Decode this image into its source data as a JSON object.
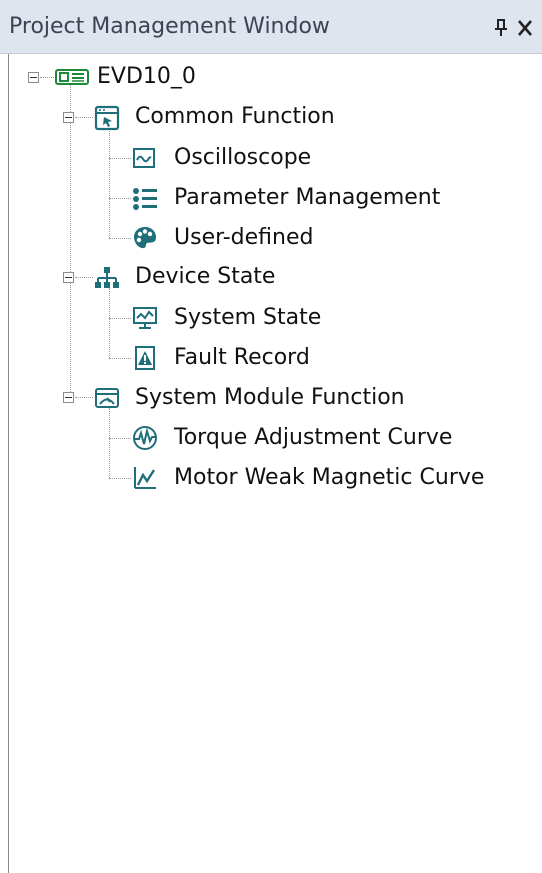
{
  "window": {
    "title": "Project Management Window",
    "pin_label": "pin",
    "close_label": "close"
  },
  "tree": {
    "root": {
      "label": "EVD10_0",
      "icon": "device-icon"
    },
    "groups": [
      {
        "label": "Common Function",
        "icon": "window-cursor-icon",
        "children": [
          {
            "label": "Oscilloscope",
            "icon": "waveform-icon"
          },
          {
            "label": "Parameter Management",
            "icon": "list-icon"
          },
          {
            "label": "User-defined",
            "icon": "palette-icon"
          }
        ]
      },
      {
        "label": "Device State",
        "icon": "network-tree-icon",
        "children": [
          {
            "label": "System State",
            "icon": "monitor-icon"
          },
          {
            "label": "Fault Record",
            "icon": "fault-record-icon"
          }
        ]
      },
      {
        "label": "System Module Function",
        "icon": "module-window-icon",
        "children": [
          {
            "label": "Torque Adjustment Curve",
            "icon": "pulse-circle-icon"
          },
          {
            "label": "Motor Weak Magnetic Curve",
            "icon": "line-chart-icon"
          }
        ]
      }
    ]
  },
  "colors": {
    "titlebar_bg": "#dfe5ef",
    "icon_teal": "#1f6f7a",
    "icon_green": "#1d8a3a",
    "icon_blue": "#1f5f9e"
  }
}
